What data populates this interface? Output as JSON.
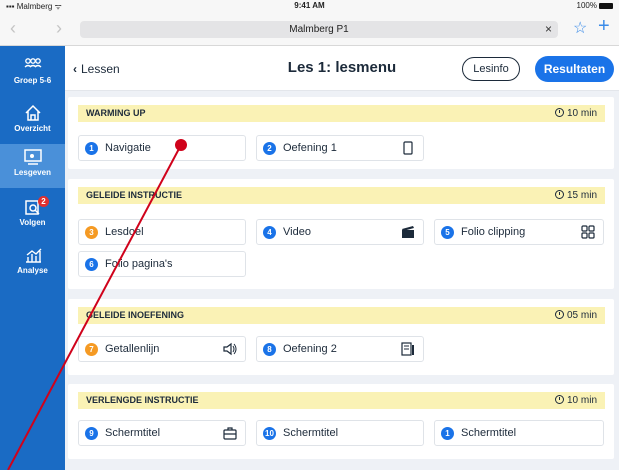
{
  "status": {
    "carrier": "Malmberg",
    "time": "9:41 AM",
    "battery": "100%"
  },
  "browser": {
    "url": "Malmberg P1",
    "clear": "×"
  },
  "sidebar": {
    "items": [
      {
        "label": "Groep 5-6",
        "icon": "group-icon"
      },
      {
        "label": "Overzicht",
        "icon": "home-icon"
      },
      {
        "label": "Lesgeven",
        "icon": "teach-icon",
        "active": true
      },
      {
        "label": "Volgen",
        "icon": "track-icon",
        "badge": "2"
      },
      {
        "label": "Analyse",
        "icon": "chart-icon"
      }
    ]
  },
  "header": {
    "back_label": "Lessen",
    "title": "Les 1: lesmenu",
    "info_button": "Lesinfo",
    "results_button": "Resultaten"
  },
  "sections": [
    {
      "title": "WARMING UP",
      "time": "10 min",
      "cards": [
        {
          "num": "1",
          "label": "Navigatie",
          "color": "blue",
          "icon": ""
        },
        {
          "num": "2",
          "label": "Oefening 1",
          "color": "blue",
          "icon": "tablet-icon"
        }
      ]
    },
    {
      "title": "GELEIDE INSTRUCTIE",
      "time": "15 min",
      "cards": [
        {
          "num": "3",
          "label": "Lesdoel",
          "color": "orange",
          "icon": ""
        },
        {
          "num": "4",
          "label": "Video",
          "color": "blue",
          "icon": "clapper-icon"
        },
        {
          "num": "5",
          "label": "Folio clipping",
          "color": "blue",
          "icon": "gallery-icon"
        },
        {
          "num": "6",
          "label": "Folio pagina's",
          "color": "blue",
          "icon": ""
        }
      ]
    },
    {
      "title": "GELEIDE INOEFENING",
      "time": "05 min",
      "cards": [
        {
          "num": "7",
          "label": "Getallenlijn",
          "color": "orange",
          "icon": "speaker-icon"
        },
        {
          "num": "8",
          "label": "Oefening 2",
          "color": "blue",
          "icon": "worksheet-icon"
        }
      ]
    },
    {
      "title": "VERLENGDE INSTRUCTIE",
      "time": "10 min",
      "cards": [
        {
          "num": "9",
          "label": "Schermtitel",
          "color": "blue",
          "icon": "briefcase-icon"
        },
        {
          "num": "10",
          "label": "Schermtitel",
          "color": "blue",
          "icon": ""
        },
        {
          "num": "1",
          "label": "Schermtitel",
          "color": "blue",
          "icon": ""
        }
      ]
    }
  ],
  "colors": {
    "sidebar": "#1a6bc4",
    "accent": "#1a73e8",
    "orange": "#f59a23",
    "section_header": "#faf2b5",
    "annotation": "#d0021b"
  }
}
